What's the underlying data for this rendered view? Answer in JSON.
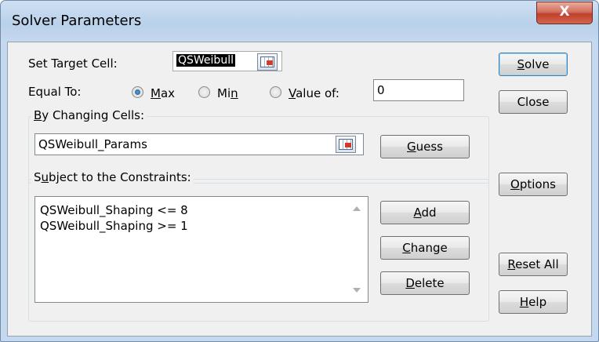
{
  "window": {
    "title": "Solver Parameters",
    "close_glyph": "X"
  },
  "target": {
    "label": "Set Target Cell:",
    "value": "QSWeibull"
  },
  "equal_to": {
    "label": "Equal To:",
    "options": [
      {
        "label": "Max",
        "selected": true
      },
      {
        "label": "Min",
        "selected": false
      },
      {
        "label": "Value of:",
        "selected": false
      }
    ],
    "value": "0"
  },
  "changing": {
    "label": "By Changing Cells:",
    "value": "QSWeibull_Params",
    "guess_label": "Guess"
  },
  "constraints": {
    "label": "Subject to the Constraints:",
    "items": [
      "QSWeibull_Shaping <= 8",
      "QSWeibull_Shaping >= 1"
    ],
    "add_label": "Add",
    "change_label": "Change",
    "delete_label": "Delete"
  },
  "side_buttons": {
    "solve": "Solve",
    "close": "Close",
    "options": "Options",
    "reset_all": "Reset All",
    "help": "Help"
  }
}
